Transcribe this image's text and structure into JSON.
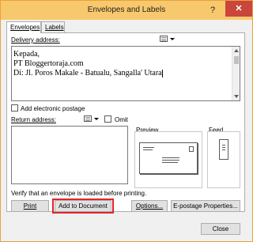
{
  "window": {
    "title": "Envelopes and Labels",
    "help_label": "?",
    "close_label": "✕"
  },
  "tabs": [
    {
      "label": "Envelopes",
      "active": true
    },
    {
      "label": "Labels",
      "active": false
    }
  ],
  "delivery": {
    "label": "Delivery address:",
    "address_lines": [
      "Kepada,",
      "PT Bloggertoraja.com",
      "Di: Jl. Poros Makale - Batualu, Sangalla' Utara"
    ]
  },
  "electronic_postage": {
    "label": "Add electronic postage",
    "checked": false
  },
  "return": {
    "label": "Return address:",
    "omit_label": "Omit",
    "omit_checked": false,
    "value": ""
  },
  "preview_label": "Preview",
  "feed_label": "Feed",
  "verify_text": "Verify that an envelope is loaded before printing.",
  "buttons": {
    "print": "Print",
    "add_to_document": "Add to Document",
    "options": "Options...",
    "epostage": "E-postage Properties...",
    "close": "Close"
  },
  "icons": {
    "address_book": "address-book-icon",
    "dropdown": "chevron-down-icon"
  },
  "colors": {
    "titlebar": "#f8c86c",
    "close_button": "#c8463b",
    "highlight": "#e0242b"
  }
}
